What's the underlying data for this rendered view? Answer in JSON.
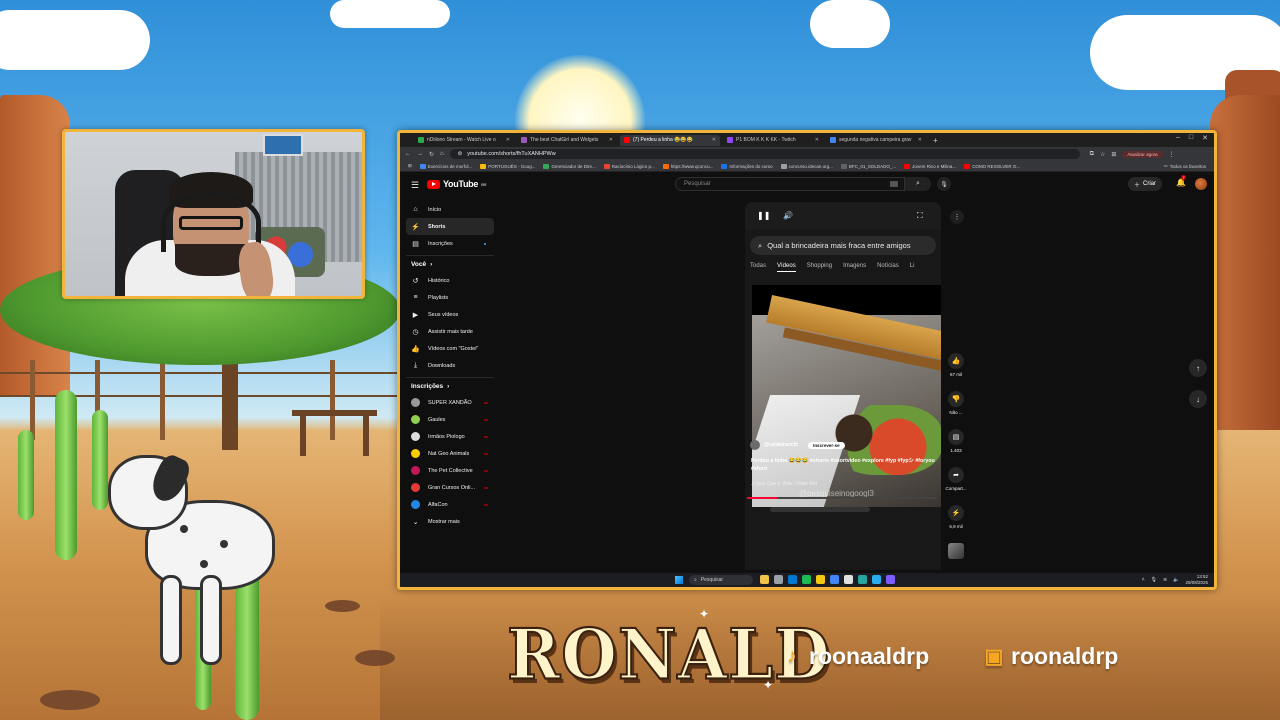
{
  "overlay": {
    "streamer_name": "RONALD",
    "tiktok_handle": "roonaaldrp",
    "twitch_handle": "roonaldrp",
    "accent_color": "#f2b43a"
  },
  "browser": {
    "tabs": [
      {
        "label": "nDiilono Stream - Watch Live o",
        "icon_color": "#2aa84a",
        "active": false
      },
      {
        "label": "The best ChatGirl and Widgets",
        "icon_color": "#9b59b6",
        "active": false
      },
      {
        "label": "(7) Perdeu a linha 😂😂😂",
        "icon_color": "#ff0000",
        "active": true
      },
      {
        "label": "P1 BOM K K K KK - Twitch",
        "icon_color": "#9146ff",
        "active": false
      },
      {
        "label": "segunda negativa campeira grav",
        "icon_color": "#4285f4",
        "active": false
      }
    ],
    "url": "youtube.com/shorts/fhTuXANHPWw",
    "update_label": "Atualizar agora",
    "bookmarks": [
      {
        "label": "Exercícios de morfol...",
        "icon_color": "#4285f4"
      },
      {
        "label": "PORTUGUÊS - Goog...",
        "icon_color": "#fbbc05"
      },
      {
        "label": "Gerenciador de Dire...",
        "icon_color": "#34a853"
      },
      {
        "label": "Raciocínio Lógico p...",
        "icon_color": "#ea4335"
      },
      {
        "label": "https://www.qconcu...",
        "icon_color": "#ff6d00"
      },
      {
        "label": "Informações do curso",
        "icon_color": "#1a73e8"
      },
      {
        "label": "concurso.idecan.org...",
        "icon_color": "#9aa0a6"
      },
      {
        "label": "BFC_01_SOLDADO_...",
        "icon_color": "#5f6368"
      },
      {
        "label": "Jovem Rico e Milina...",
        "icon_color": "#ff0000"
      },
      {
        "label": "COMO RESOLVER O...",
        "icon_color": "#ff0000"
      }
    ],
    "all_bookmarks_label": "Todos os favoritos"
  },
  "youtube": {
    "logo_text": "YouTube",
    "logo_region": "BR",
    "search_placeholder": "Pesquisar",
    "create_label": "Criar",
    "notification_count": "7",
    "nav": [
      {
        "label": "Início",
        "icon": "home-icon",
        "glyph": "⌂"
      },
      {
        "label": "Shorts",
        "icon": "shorts-icon",
        "glyph": "⚡",
        "active": true
      },
      {
        "label": "Inscrições",
        "icon": "subscriptions-icon",
        "glyph": "▤"
      }
    ],
    "you_section": "Você",
    "you_items": [
      {
        "label": "Histórico",
        "icon": "history-icon",
        "glyph": "↺"
      },
      {
        "label": "Playlists",
        "icon": "playlist-icon",
        "glyph": "≡"
      },
      {
        "label": "Seus vídeos",
        "icon": "your-videos-icon",
        "glyph": "▶"
      },
      {
        "label": "Assistir mais tarde",
        "icon": "watch-later-icon",
        "glyph": "◷"
      },
      {
        "label": "Vídeos com \"Gostei\"",
        "icon": "like-icon",
        "glyph": "👍"
      },
      {
        "label": "Downloads",
        "icon": "download-icon",
        "glyph": "⤓"
      }
    ],
    "subs_section": "Inscrições",
    "subscriptions": [
      {
        "label": "SUPER XANDÃO",
        "color": "#999999"
      },
      {
        "label": "Gaules",
        "color": "#8fd14f"
      },
      {
        "label": "Irmãos Piologo",
        "color": "#dddddd"
      },
      {
        "label": "Nat Geo Animals",
        "color": "#ffcc00"
      },
      {
        "label": "The Pet Collective",
        "color": "#c2185b"
      },
      {
        "label": "Gran Cursos Onli...",
        "color": "#e53935"
      },
      {
        "label": "AlfaCon",
        "color": "#1e88e5"
      }
    ],
    "show_more_label": "Mostrar mais",
    "short": {
      "google_query": "Qual a brincadeira mais fraca entre amigos",
      "google_tabs": [
        "Todas",
        "Vídeos",
        "Shopping",
        "Imagens",
        "Notícias",
        "Li"
      ],
      "active_google_tab": 1,
      "channel": "@caldeiraocfc",
      "subscribe_label": "Inscrever-se",
      "caption": "Perdeu a linha 😂😂😂 #shorts #shortvideo #explore #fyp #fypシ #foryou #short",
      "music": "♫ Isso Que é Vida · Filipe Ret",
      "watermark": "@pesquiseinogoogl3",
      "progress": 0.16,
      "likes": "67 mil",
      "dislike_label": "Não ...",
      "comments": "1.403",
      "share_label": "Compart...",
      "remix_count": "6,9 mil"
    }
  },
  "taskbar": {
    "search_label": "Pesquisar",
    "time": "13:52",
    "date": "29/08/2025",
    "app_colors": [
      "#f0c24a",
      "#9aa0a6",
      "#0078d4",
      "#1db954",
      "#f2c811",
      "#4285f4",
      "#e0e0e0",
      "#26a5a0",
      "#2aabee",
      "#7a5cff"
    ]
  }
}
